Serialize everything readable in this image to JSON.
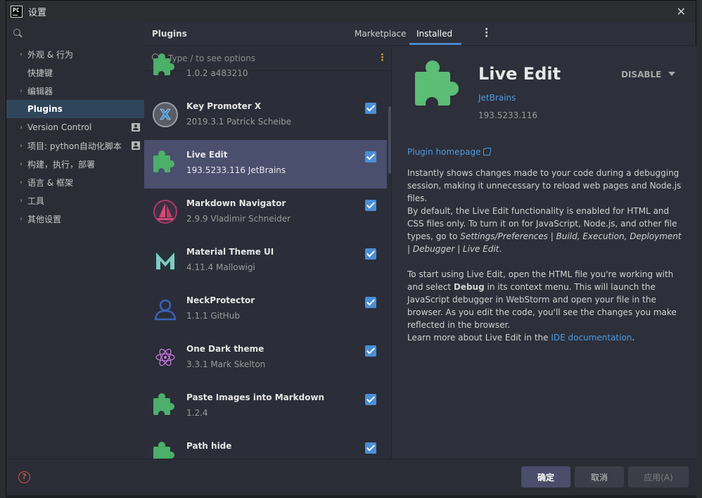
{
  "window": {
    "title": "设置",
    "app_logo_text": "PC"
  },
  "sidebar": {
    "items": [
      {
        "label": "外观 & 行为",
        "expandable": true
      },
      {
        "label": "快捷键",
        "expandable": false
      },
      {
        "label": "编辑器",
        "expandable": true
      },
      {
        "label": "Plugins",
        "expandable": false,
        "active": true
      },
      {
        "label": "Version Control",
        "expandable": true,
        "project_icon": true
      },
      {
        "label": "项目: python自动化脚本",
        "expandable": true,
        "project_icon": true
      },
      {
        "label": "构建，执行，部署",
        "expandable": true
      },
      {
        "label": "语言 & 框架",
        "expandable": true
      },
      {
        "label": "工具",
        "expandable": true
      },
      {
        "label": "其他设置",
        "expandable": true
      }
    ]
  },
  "header": {
    "title": "Plugins",
    "tab_marketplace": "Marketplace",
    "tab_installed": "Installed",
    "active_tab": "Installed"
  },
  "list": {
    "search_placeholder": "Type / to see options",
    "plugins": [
      {
        "name": "",
        "meta": "1.0.2  a483210",
        "icon": "puzzle-icon",
        "checked": true
      },
      {
        "name": "Key Promoter X",
        "meta": "2019.3.1  Patrick Scheibe",
        "icon": "key-promoter-x-icon",
        "checked": true
      },
      {
        "name": "Live Edit",
        "meta": "193.5233.116  JetBrains",
        "icon": "puzzle-icon",
        "checked": true,
        "selected": true
      },
      {
        "name": "Markdown Navigator",
        "meta": "2.9.9  Vladimir Schneider",
        "icon": "markdown-navigator-icon",
        "checked": true
      },
      {
        "name": "Material Theme UI",
        "meta": "4.11.4  Mallowigi",
        "icon": "material-theme-icon",
        "checked": true
      },
      {
        "name": "NeckProtector",
        "meta": "1.1.1  GitHub",
        "icon": "neck-protector-icon",
        "checked": true
      },
      {
        "name": "One Dark theme",
        "meta": "3.3.1  Mark Skelton",
        "icon": "one-dark-atom-icon",
        "checked": true
      },
      {
        "name": "Paste Images into Markdown",
        "meta": "1.2.4",
        "icon": "puzzle-icon",
        "checked": true
      },
      {
        "name": "Path hide",
        "meta": "",
        "icon": "puzzle-icon",
        "checked": true
      }
    ]
  },
  "details": {
    "name": "Live Edit",
    "vendor": "JetBrains",
    "version": "193.5233.116",
    "disable_label": "DISABLE",
    "homepage_label": "Plugin homepage",
    "para1": "Instantly shows changes made to your code during a debugging session, making it unnecessary to reload web pages and Node.js files.",
    "para2_text": "By default, the Live Edit functionality is enabled for HTML and CSS files only. To turn it on for JavaScript, Node.js, and other file types, go to ",
    "para2_italic": "Settings/Preferences | Build, Execution, Deployment | Debugger | Live Edit",
    "para2_end": ".",
    "para3_a": "To start using Live Edit, open the HTML file you're working with and select ",
    "para3_bold": "Debug",
    "para3_b": " in its context menu. This will launch the JavaScript debugger in WebStorm and open your file in the browser. As you edit the code, you'll see the changes you make reflected in the browser.",
    "para4_a": "Learn more about Live Edit in the ",
    "para4_link": "IDE documentation",
    "para4_b": "."
  },
  "footer": {
    "help": "?",
    "ok": "确定",
    "cancel": "取消",
    "apply": "应用(A)"
  },
  "colors": {
    "accent": "#4a8fd6",
    "link": "#4d9be0",
    "selected_row": "#4b4f6e",
    "plugin_green": "#4caf6a"
  }
}
